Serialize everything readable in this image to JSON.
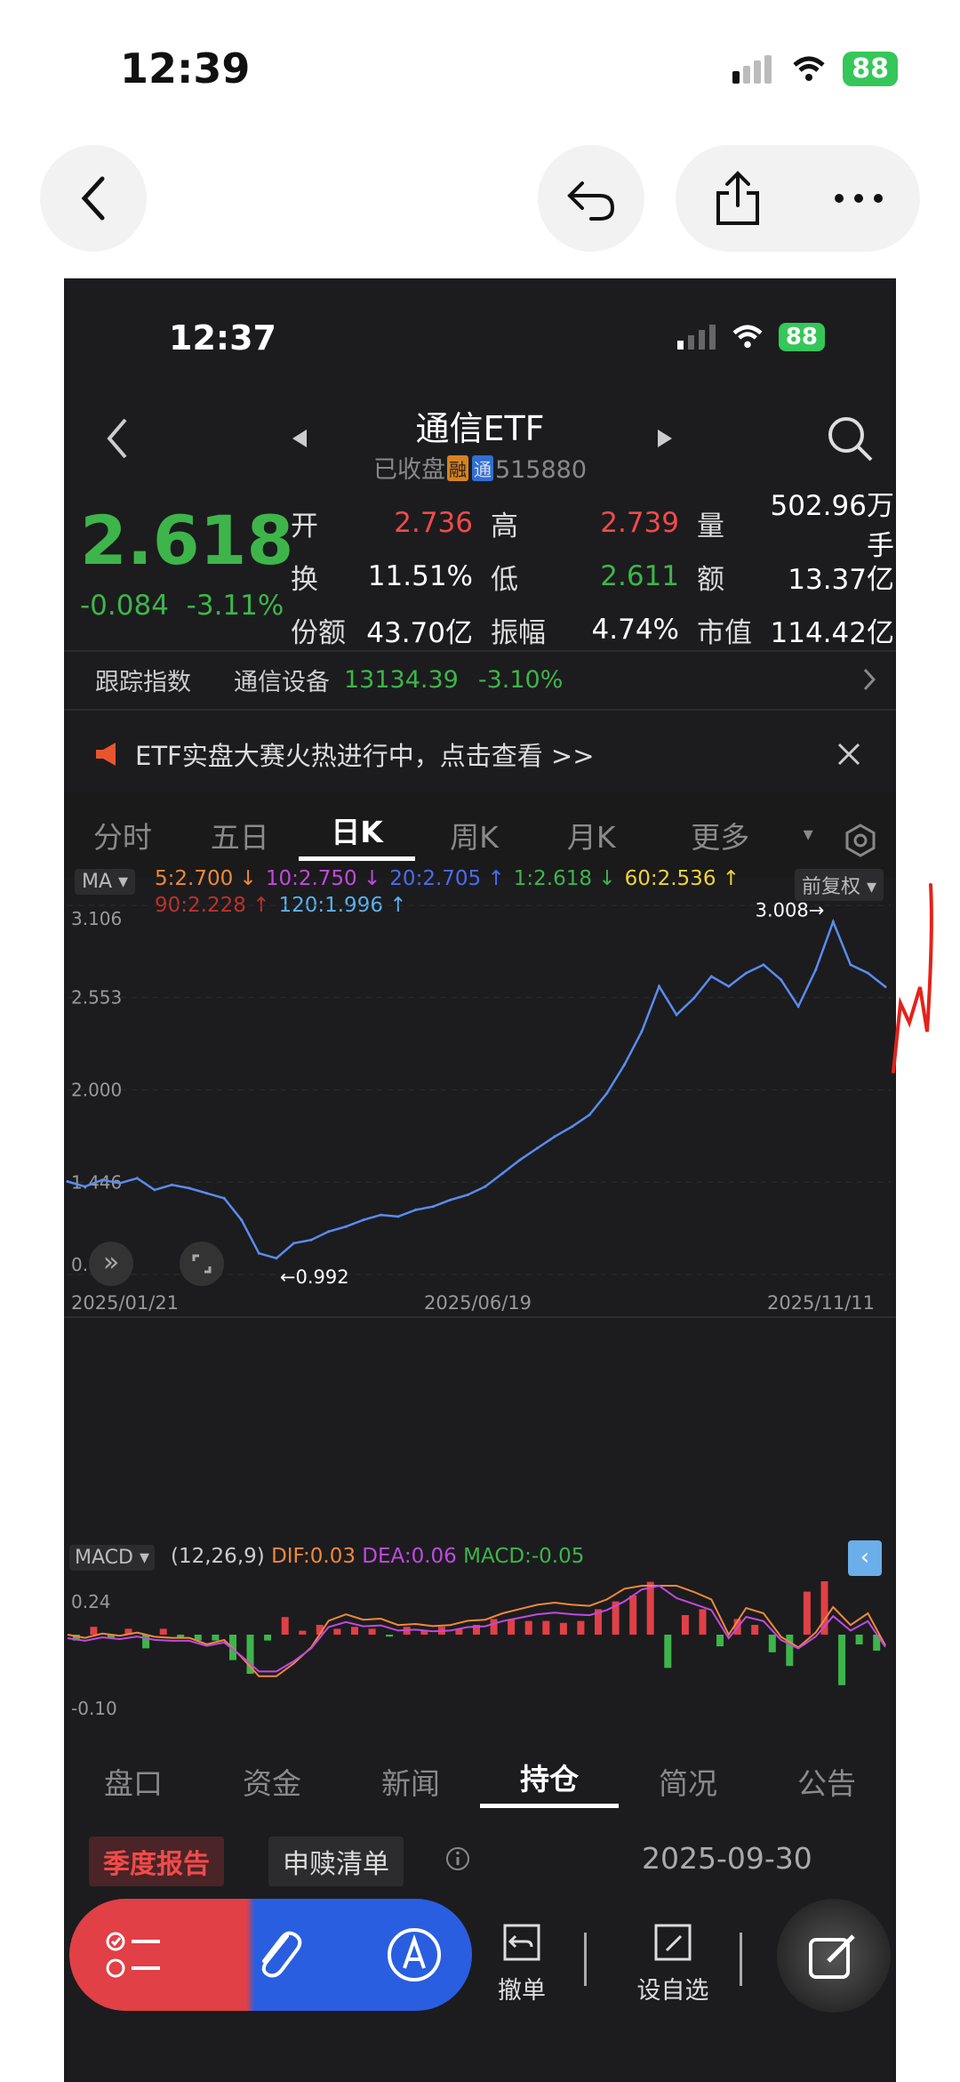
{
  "outer": {
    "time": "12:39",
    "battery": "88",
    "icons": [
      "back-icon",
      "reply-icon",
      "share-icon",
      "more-icon"
    ]
  },
  "phone": {
    "time": "12:37",
    "battery": "88",
    "title": "通信ETF",
    "status": "已收盘",
    "tag1": "融",
    "tag2": "通",
    "code": "515880",
    "price": "2.618",
    "change": "-0.084",
    "change_pct": "-3.11%",
    "quote": [
      [
        {
          "l": "开",
          "v": "2.736",
          "c": "red"
        },
        {
          "l": "高",
          "v": "2.739",
          "c": "red"
        },
        {
          "l": "量",
          "v": "502.96万手",
          "c": "white"
        }
      ],
      [
        {
          "l": "换",
          "v": "11.51%",
          "c": "white"
        },
        {
          "l": "低",
          "v": "2.611",
          "c": "green"
        },
        {
          "l": "额",
          "v": "13.37亿",
          "c": "white"
        }
      ],
      [
        {
          "l": "份额",
          "v": "43.70亿",
          "c": "white"
        },
        {
          "l": "振幅",
          "v": "4.74%",
          "c": "white"
        },
        {
          "l": "市值",
          "v": "114.42亿",
          "c": "white"
        }
      ]
    ],
    "tracking": {
      "label": "跟踪指数",
      "index": "通信设备",
      "value": "13134.39",
      "pct": "-3.10%"
    },
    "banner": "ETF实盘大赛火热进行中，点击查看 >>",
    "period_tabs": [
      "分时",
      "五日",
      "日K",
      "周K",
      "月K",
      "更多"
    ],
    "active_tab": "日K",
    "ma_label": "MA",
    "ma_items": [
      {
        "t": "5:2.700",
        "a": "↓",
        "c": "#f0883a"
      },
      {
        "t": "10:2.750",
        "a": "↓",
        "c": "#c04ae0"
      },
      {
        "t": "20:2.705",
        "a": "↑",
        "c": "#4a6cf0"
      },
      {
        "t": "1:2.618",
        "a": "↓",
        "c": "#3db54a"
      },
      {
        "t": "60:2.536",
        "a": "↑",
        "c": "#f0d23a"
      }
    ],
    "ma_items2": [
      {
        "t": "90:2.228",
        "a": "↑",
        "c": "#c0302b"
      },
      {
        "t": "120:1.996",
        "a": "↑",
        "c": "#5ab0f0"
      }
    ],
    "adjust": "前复权",
    "y_ticks": [
      "3.106",
      "2.553",
      "2.000",
      "1.446",
      "0.893"
    ],
    "x_ticks": [
      "2025/01/21",
      "2025/06/19",
      "2025/11/11"
    ],
    "high_label": "3.008→",
    "low_label": "←0.992",
    "macd": {
      "name": "MACD",
      "params": "(12,26,9)",
      "dif": "DIF:0.03",
      "dea": "DEA:0.06",
      "macd": "MACD:-0.05",
      "top": "0.24",
      "bottom": "-0.10"
    },
    "bottom_tabs": [
      "盘口",
      "资金",
      "新闻",
      "持仓",
      "简况",
      "公告"
    ],
    "active_bottom": "持仓",
    "report_tag": "季度报告",
    "list_tag": "申赎清单",
    "date": "2025-09-30",
    "toolbar": {
      "cancel": "撤单",
      "watch": "设自选"
    }
  },
  "chart_data": {
    "type": "line",
    "title": "",
    "x": [
      "2025/01/21",
      "2025/06/19",
      "2025/11/11"
    ],
    "ylim": [
      0.893,
      3.106
    ],
    "series": [
      {
        "name": "",
        "values": [
          1.45,
          1.42,
          1.46,
          1.44,
          1.47,
          1.4,
          1.43,
          1.41,
          1.38,
          1.35,
          1.22,
          1.02,
          0.99,
          1.08,
          1.1,
          1.15,
          1.18,
          1.22,
          1.25,
          1.24,
          1.28,
          1.3,
          1.34,
          1.37,
          1.42,
          1.5,
          1.58,
          1.65,
          1.72,
          1.78,
          1.85,
          1.98,
          2.15,
          2.35,
          2.62,
          2.45,
          2.55,
          2.68,
          2.62,
          2.7,
          2.75,
          2.66,
          2.5,
          2.72,
          3.008,
          2.75,
          2.7,
          2.618
        ]
      }
    ]
  }
}
